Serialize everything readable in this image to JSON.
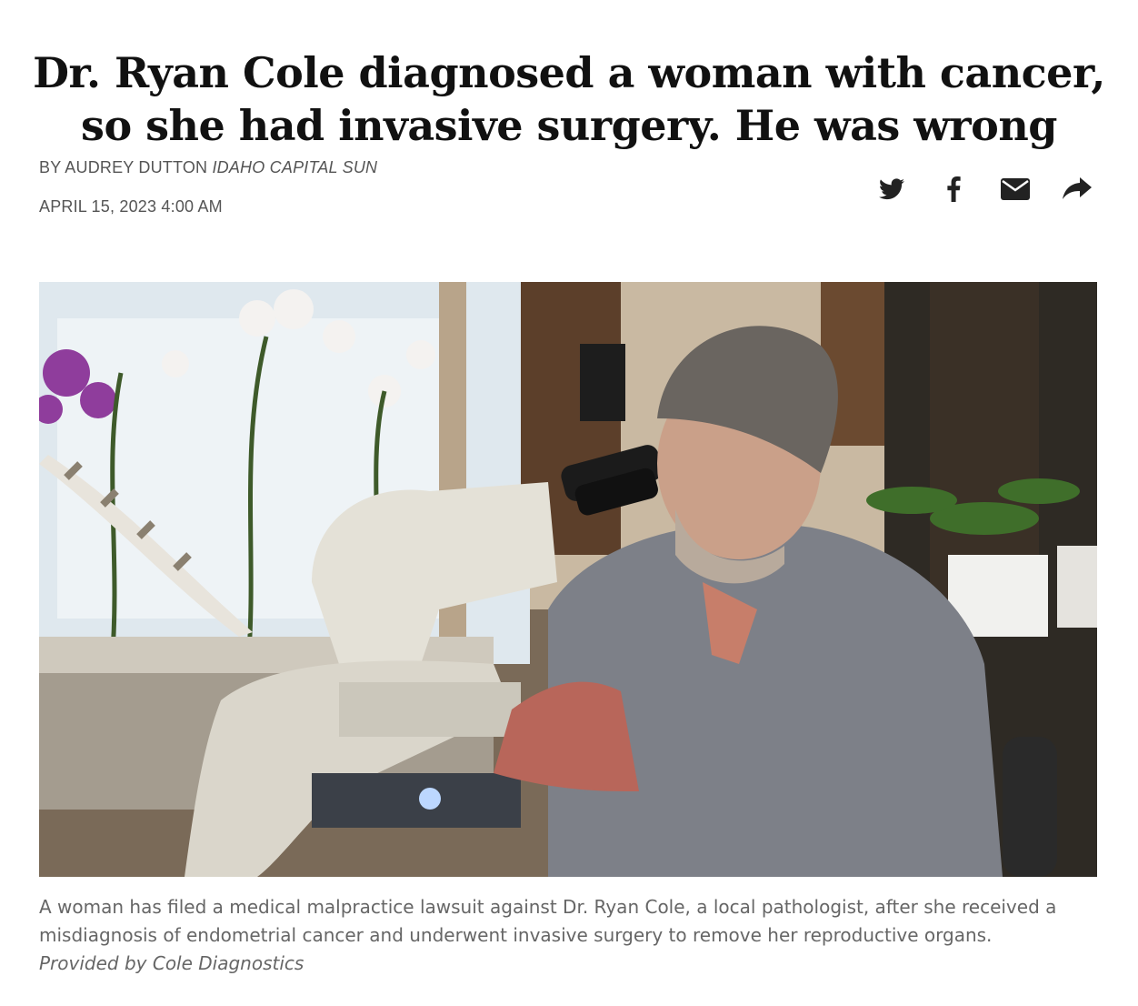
{
  "article": {
    "headline_line1": "Dr. Ryan Cole diagnosed a woman with cancer,",
    "headline_line2": "so she had invasive surgery. He was wrong",
    "byline_prefix": "By Audrey Dutton",
    "outlet": "Idaho Capital Sun",
    "date": "April 15, 2023 4:00 AM"
  },
  "share": {
    "icons": [
      "twitter-icon",
      "facebook-icon",
      "email-icon",
      "share-arrow-icon"
    ],
    "color": "#222222"
  },
  "photo": {
    "alt": "Man in gray scrubs looking into a microscope in an office with orchids"
  },
  "caption": {
    "text": "A woman has filed a medical malpractice lawsuit against Dr. Ryan Cole, a local pathologist, after she received a misdiagnosis of endometrial cancer and underwent invasive surgery to remove her reproductive organs.",
    "credit": "Provided by Cole Diagnostics"
  }
}
